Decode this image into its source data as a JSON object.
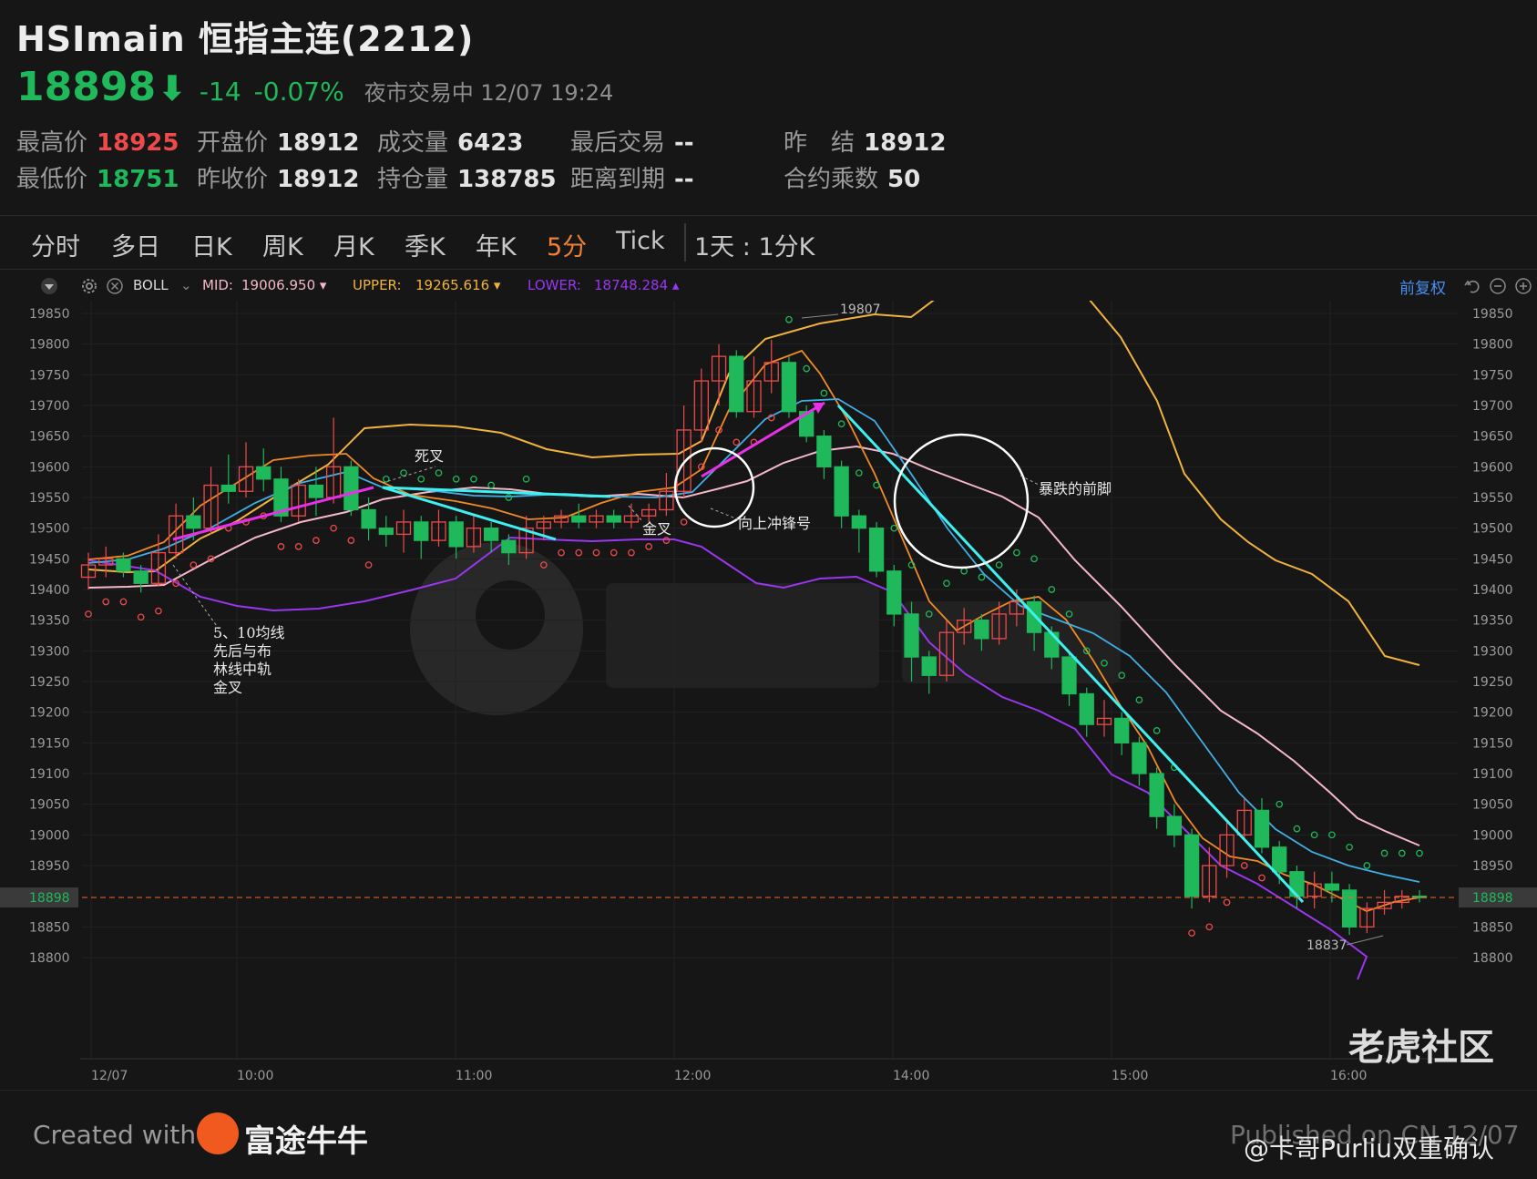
{
  "header": {
    "title": "HSImain 恒指主连(2212)",
    "price": "18898",
    "arrow": "⬇",
    "change": "-14",
    "change_pct": "-0.07%",
    "status": "夜市交易中 12/07 19:24"
  },
  "stats": [
    {
      "label": "最高价",
      "value": "18925",
      "tone": "red"
    },
    {
      "label": "开盘价",
      "value": "18912",
      "tone": "white"
    },
    {
      "label": "成交量",
      "value": "6423",
      "tone": "white"
    },
    {
      "label": "最后交易",
      "value": "--",
      "tone": "white"
    },
    {
      "label": "昨　结",
      "value": "18912",
      "tone": "white"
    },
    {
      "label": "最低价",
      "value": "18751",
      "tone": "green"
    },
    {
      "label": "昨收价",
      "value": "18912",
      "tone": "white"
    },
    {
      "label": "持仓量",
      "value": "138785",
      "tone": "white"
    },
    {
      "label": "距离到期",
      "value": "--",
      "tone": "white"
    },
    {
      "label": "合约乘数",
      "value": "50",
      "tone": "white"
    }
  ],
  "tabs": [
    "分时",
    "多日",
    "日K",
    "周K",
    "月K",
    "季K",
    "年K",
    "5分",
    "Tick",
    "1天 : 1分K"
  ],
  "active_tab": "5分",
  "indicator": {
    "name": "BOLL",
    "mid_label": "MID:",
    "mid_value": "19006.950 ▾",
    "upper_label": "UPPER:",
    "upper_value": "19265.616 ▾",
    "lower_label": "LOWER:",
    "lower_value": "18748.284 ▴",
    "adjust": "前复权"
  },
  "colors": {
    "up": "#ee4a4a",
    "down": "#1fb85a",
    "upper": "#f2b33d",
    "mid": "#f6b8c8",
    "lower": "#8a2be2",
    "ma5": "#f08a24",
    "ma10": "#3fb0e6",
    "pink_arrow": "#e830e8",
    "cyan_arrow": "#3ff0f0",
    "accent": "#f08030"
  },
  "chart_data": {
    "type": "candlestick",
    "y_ticks": [
      19850,
      19800,
      19750,
      19700,
      19650,
      19600,
      19550,
      19500,
      19450,
      19400,
      19350,
      19300,
      19250,
      19200,
      19150,
      19100,
      19050,
      19000,
      18950,
      18898,
      18850,
      18800
    ],
    "x_ticks": [
      "12/07",
      "10:00",
      "11:00",
      "12:00",
      "14:00",
      "15:00",
      "16:00"
    ],
    "last_price": 18898,
    "high_mark": "19807",
    "low_mark": "18837",
    "annotations": [
      "死叉",
      "金叉",
      "向上冲锋号",
      "暴跌的前脚",
      "5、10均线",
      "先后与布",
      "林线中轨",
      "金叉"
    ],
    "candles": [
      [
        19420,
        19440,
        19400,
        19460
      ],
      [
        19440,
        19450,
        19420,
        19470
      ],
      [
        19450,
        19430,
        19420,
        19460
      ],
      [
        19430,
        19410,
        19395,
        19440
      ],
      [
        19410,
        19460,
        19405,
        19490
      ],
      [
        19460,
        19520,
        19450,
        19540
      ],
      [
        19520,
        19500,
        19480,
        19550
      ],
      [
        19500,
        19570,
        19490,
        19600
      ],
      [
        19570,
        19560,
        19540,
        19620
      ],
      [
        19560,
        19600,
        19550,
        19640
      ],
      [
        19600,
        19580,
        19560,
        19630
      ],
      [
        19580,
        19520,
        19510,
        19600
      ],
      [
        19520,
        19570,
        19510,
        19580
      ],
      [
        19570,
        19550,
        19520,
        19600
      ],
      [
        19550,
        19600,
        19540,
        19680
      ],
      [
        19600,
        19530,
        19520,
        19610
      ],
      [
        19530,
        19500,
        19480,
        19550
      ],
      [
        19500,
        19490,
        19470,
        19520
      ],
      [
        19490,
        19510,
        19460,
        19530
      ],
      [
        19510,
        19480,
        19450,
        19520
      ],
      [
        19480,
        19510,
        19470,
        19530
      ],
      [
        19510,
        19470,
        19450,
        19520
      ],
      [
        19470,
        19500,
        19460,
        19520
      ],
      [
        19500,
        19480,
        19460,
        19510
      ],
      [
        19480,
        19460,
        19440,
        19490
      ],
      [
        19460,
        19500,
        19450,
        19520
      ],
      [
        19500,
        19510,
        19480,
        19520
      ],
      [
        19510,
        19520,
        19500,
        19530
      ],
      [
        19520,
        19510,
        19500,
        19540
      ],
      [
        19510,
        19520,
        19500,
        19530
      ],
      [
        19520,
        19510,
        19500,
        19530
      ],
      [
        19510,
        19520,
        19500,
        19540
      ],
      [
        19520,
        19530,
        19510,
        19540
      ],
      [
        19530,
        19560,
        19520,
        19590
      ],
      [
        19560,
        19660,
        19550,
        19700
      ],
      [
        19660,
        19740,
        19640,
        19760
      ],
      [
        19740,
        19780,
        19700,
        19800
      ],
      [
        19780,
        19690,
        19680,
        19790
      ],
      [
        19690,
        19740,
        19680,
        19780
      ],
      [
        19740,
        19770,
        19720,
        19807
      ],
      [
        19770,
        19690,
        19680,
        19780
      ],
      [
        19690,
        19650,
        19640,
        19700
      ],
      [
        19650,
        19600,
        19580,
        19660
      ],
      [
        19600,
        19520,
        19500,
        19610
      ],
      [
        19520,
        19500,
        19460,
        19530
      ],
      [
        19500,
        19430,
        19420,
        19510
      ],
      [
        19430,
        19360,
        19340,
        19440
      ],
      [
        19360,
        19290,
        19250,
        19380
      ],
      [
        19290,
        19260,
        19230,
        19300
      ],
      [
        19260,
        19330,
        19250,
        19350
      ],
      [
        19330,
        19350,
        19310,
        19370
      ],
      [
        19350,
        19320,
        19300,
        19360
      ],
      [
        19320,
        19360,
        19310,
        19380
      ],
      [
        19360,
        19380,
        19340,
        19400
      ],
      [
        19380,
        19330,
        19300,
        19390
      ],
      [
        19330,
        19290,
        19270,
        19340
      ],
      [
        19290,
        19230,
        19210,
        19300
      ],
      [
        19230,
        19180,
        19160,
        19240
      ],
      [
        19180,
        19190,
        19160,
        19220
      ],
      [
        19190,
        19150,
        19130,
        19200
      ],
      [
        19150,
        19100,
        19080,
        19160
      ],
      [
        19100,
        19030,
        19010,
        19110
      ],
      [
        19030,
        19000,
        18980,
        19050
      ],
      [
        19000,
        18900,
        18880,
        19010
      ],
      [
        18900,
        18950,
        18890,
        18980
      ],
      [
        18950,
        19000,
        18930,
        19020
      ],
      [
        19000,
        19040,
        18990,
        19060
      ],
      [
        19040,
        18980,
        18970,
        19060
      ],
      [
        18980,
        18940,
        18920,
        18990
      ],
      [
        18940,
        18900,
        18880,
        18950
      ],
      [
        18900,
        18920,
        18880,
        18940
      ],
      [
        18920,
        18910,
        18890,
        18940
      ],
      [
        18910,
        18850,
        18837,
        18920
      ],
      [
        18850,
        18880,
        18840,
        18890
      ],
      [
        18880,
        18890,
        18870,
        18910
      ],
      [
        18890,
        18900,
        18880,
        18910
      ],
      [
        18900,
        18898,
        18890,
        18910
      ]
    ]
  },
  "footer": {
    "created": "Created with",
    "brand": "富途牛牛",
    "published": "Published on CN 12/07",
    "watermark_brand": "老虎社区",
    "watermark_user": "@卡哥Purliu双重确认"
  }
}
